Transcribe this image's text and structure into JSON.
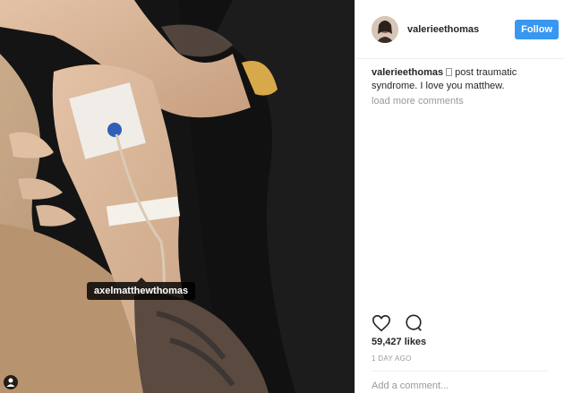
{
  "photo": {
    "tag_label": "axelmatthewthomas",
    "user_tag_icon": "person-icon"
  },
  "header": {
    "username": "valerieethomas",
    "follow_label": "Follow"
  },
  "caption": {
    "username": "valerieethomas",
    "text": "post traumatic syndrome. I love you matthew."
  },
  "comments": {
    "load_more": "load more comments"
  },
  "actions": {
    "like_icon": "heart-icon",
    "comment_icon": "comment-icon"
  },
  "likes": "59,427 likes",
  "timestamp": "1 DAY AGO",
  "comment_input": {
    "placeholder": "Add a comment..."
  },
  "colors": {
    "accent": "#3897f0",
    "text": "#262626",
    "muted": "#999999"
  }
}
